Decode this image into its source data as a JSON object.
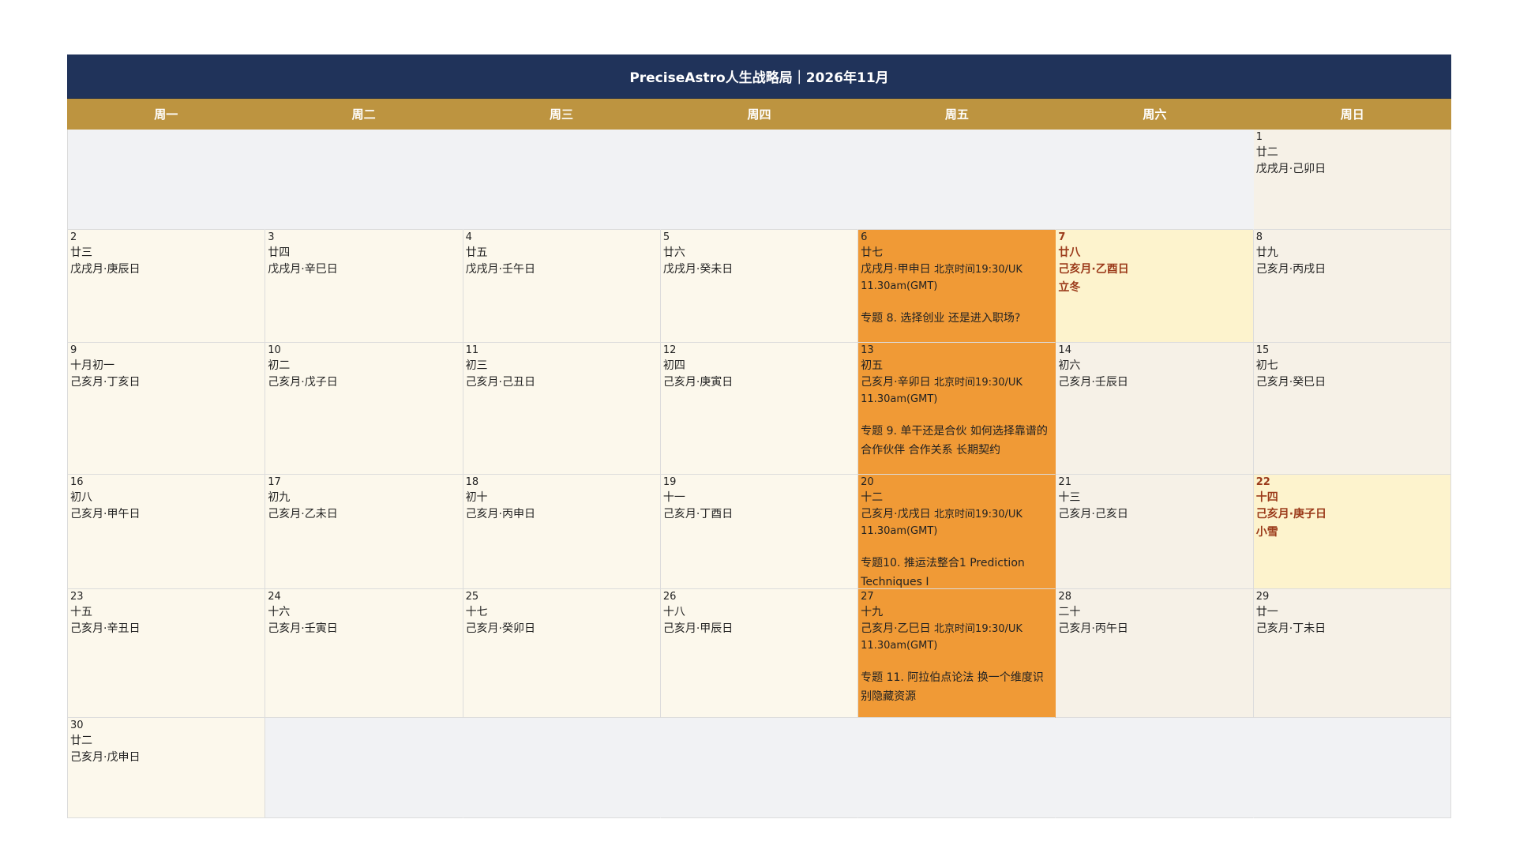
{
  "title": "PreciseAstro人生战略局｜2026年11月",
  "weekdays": [
    "周一",
    "周二",
    "周三",
    "周四",
    "周五",
    "周六",
    "周日"
  ],
  "days": [
    {
      "day": "1",
      "lunar": "廿二",
      "ganzhi": "戊戌月·己卯日",
      "weekend": true
    },
    {
      "day": "2",
      "lunar": "廿三",
      "ganzhi": "戊戌月·庚辰日"
    },
    {
      "day": "3",
      "lunar": "廿四",
      "ganzhi": "戊戌月·辛巳日"
    },
    {
      "day": "4",
      "lunar": "廿五",
      "ganzhi": "戊戌月·壬午日"
    },
    {
      "day": "5",
      "lunar": "廿六",
      "ganzhi": "戊戌月·癸未日"
    },
    {
      "day": "6",
      "lunar": "廿七",
      "ganzhi": "戊戌月·甲申日",
      "time": "北京时间19:30/UK 11.30am(GMT)",
      "topic": "专题 8. 选择创业 还是进入职场?",
      "event": true
    },
    {
      "day": "7",
      "lunar": "廿八",
      "ganzhi": "己亥月·乙酉日",
      "solar_term": "立冬",
      "term": true
    },
    {
      "day": "8",
      "lunar": "廿九",
      "ganzhi": "己亥月·丙戌日",
      "weekend": true
    },
    {
      "day": "9",
      "lunar": "十月初一",
      "ganzhi": "己亥月·丁亥日"
    },
    {
      "day": "10",
      "lunar": "初二",
      "ganzhi": "己亥月·戊子日"
    },
    {
      "day": "11",
      "lunar": "初三",
      "ganzhi": "己亥月·己丑日"
    },
    {
      "day": "12",
      "lunar": "初四",
      "ganzhi": "己亥月·庚寅日"
    },
    {
      "day": "13",
      "lunar": "初五",
      "ganzhi": "己亥月·辛卯日",
      "time": "北京时间19:30/UK 11.30am(GMT)",
      "topic": "专题 9. 单干还是合伙 如何选择靠谱的合作伙伴 合作关系 长期契约",
      "event": true
    },
    {
      "day": "14",
      "lunar": "初六",
      "ganzhi": "己亥月·壬辰日",
      "weekend": true
    },
    {
      "day": "15",
      "lunar": "初七",
      "ganzhi": "己亥月·癸巳日",
      "weekend": true
    },
    {
      "day": "16",
      "lunar": "初八",
      "ganzhi": "己亥月·甲午日"
    },
    {
      "day": "17",
      "lunar": "初九",
      "ganzhi": "己亥月·乙未日"
    },
    {
      "day": "18",
      "lunar": "初十",
      "ganzhi": "己亥月·丙申日"
    },
    {
      "day": "19",
      "lunar": "十一",
      "ganzhi": "己亥月·丁酉日"
    },
    {
      "day": "20",
      "lunar": "十二",
      "ganzhi": "己亥月·戊戌日",
      "time": "北京时间19:30/UK 11.30am(GMT)",
      "topic": "专题10. 推运法整合1 Prediction Techniques I",
      "event": true
    },
    {
      "day": "21",
      "lunar": "十三",
      "ganzhi": "己亥月·己亥日",
      "weekend": true
    },
    {
      "day": "22",
      "lunar": "十四",
      "ganzhi": "己亥月·庚子日",
      "solar_term": "小雪",
      "term": true
    },
    {
      "day": "23",
      "lunar": "十五",
      "ganzhi": "己亥月·辛丑日"
    },
    {
      "day": "24",
      "lunar": "十六",
      "ganzhi": "己亥月·壬寅日"
    },
    {
      "day": "25",
      "lunar": "十七",
      "ganzhi": "己亥月·癸卯日"
    },
    {
      "day": "26",
      "lunar": "十八",
      "ganzhi": "己亥月·甲辰日"
    },
    {
      "day": "27",
      "lunar": "十九",
      "ganzhi": "己亥月·乙巳日",
      "time": "北京时间19:30/UK 11.30am(GMT)",
      "topic": "专题 11. 阿拉伯点论法 换一个维度识别隐藏资源",
      "event": true
    },
    {
      "day": "28",
      "lunar": "二十",
      "ganzhi": "己亥月·丙午日",
      "weekend": true
    },
    {
      "day": "29",
      "lunar": "廿一",
      "ganzhi": "己亥月·丁未日",
      "weekend": true
    },
    {
      "day": "30",
      "lunar": "廿二",
      "ganzhi": "己亥月·戊申日"
    }
  ],
  "leading_blank_days": 6,
  "trailing_blank_days": 6,
  "colors": {
    "header_bg": "#20335a",
    "weekday_bg": "#bd9440",
    "event_bg": "#f09a36",
    "solar_term_text": "#9b3a1a"
  }
}
